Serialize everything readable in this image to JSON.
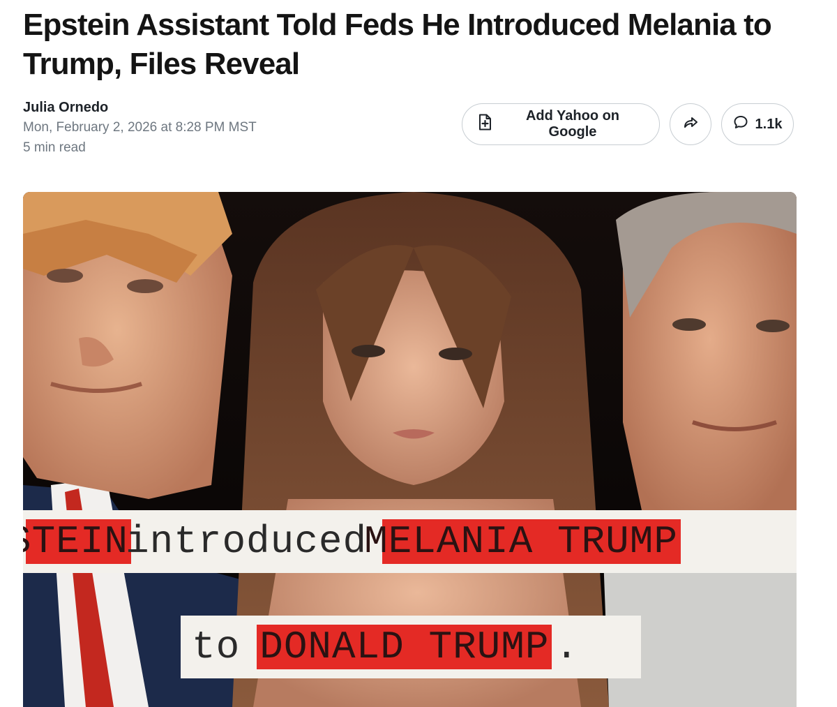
{
  "article": {
    "headline": "Epstein Assistant Told Feds He Introduced Melania to Trump, Files Reveal",
    "author": "Julia Ornedo",
    "date": "Mon, February 2, 2026 at 8:28 PM MST",
    "read_time": "5 min read"
  },
  "actions": {
    "google_label": "Add Yahoo on Google",
    "comment_count": "1.1k"
  },
  "hero": {
    "line1": {
      "word1": "STEIN",
      "word2": "introduced",
      "word3": "MELANIA TRUMP"
    },
    "line2": {
      "word1": "to",
      "word2": "DONALD TRUMP",
      "word3": "."
    }
  },
  "colors": {
    "redaction_red": "#e42a25",
    "paper": "#f3f1ec",
    "text_primary": "#141414",
    "text_secondary": "#6e7780",
    "border": "#c7cdd2"
  },
  "icons": [
    "google-news-icon",
    "share-icon",
    "comment-icon"
  ]
}
